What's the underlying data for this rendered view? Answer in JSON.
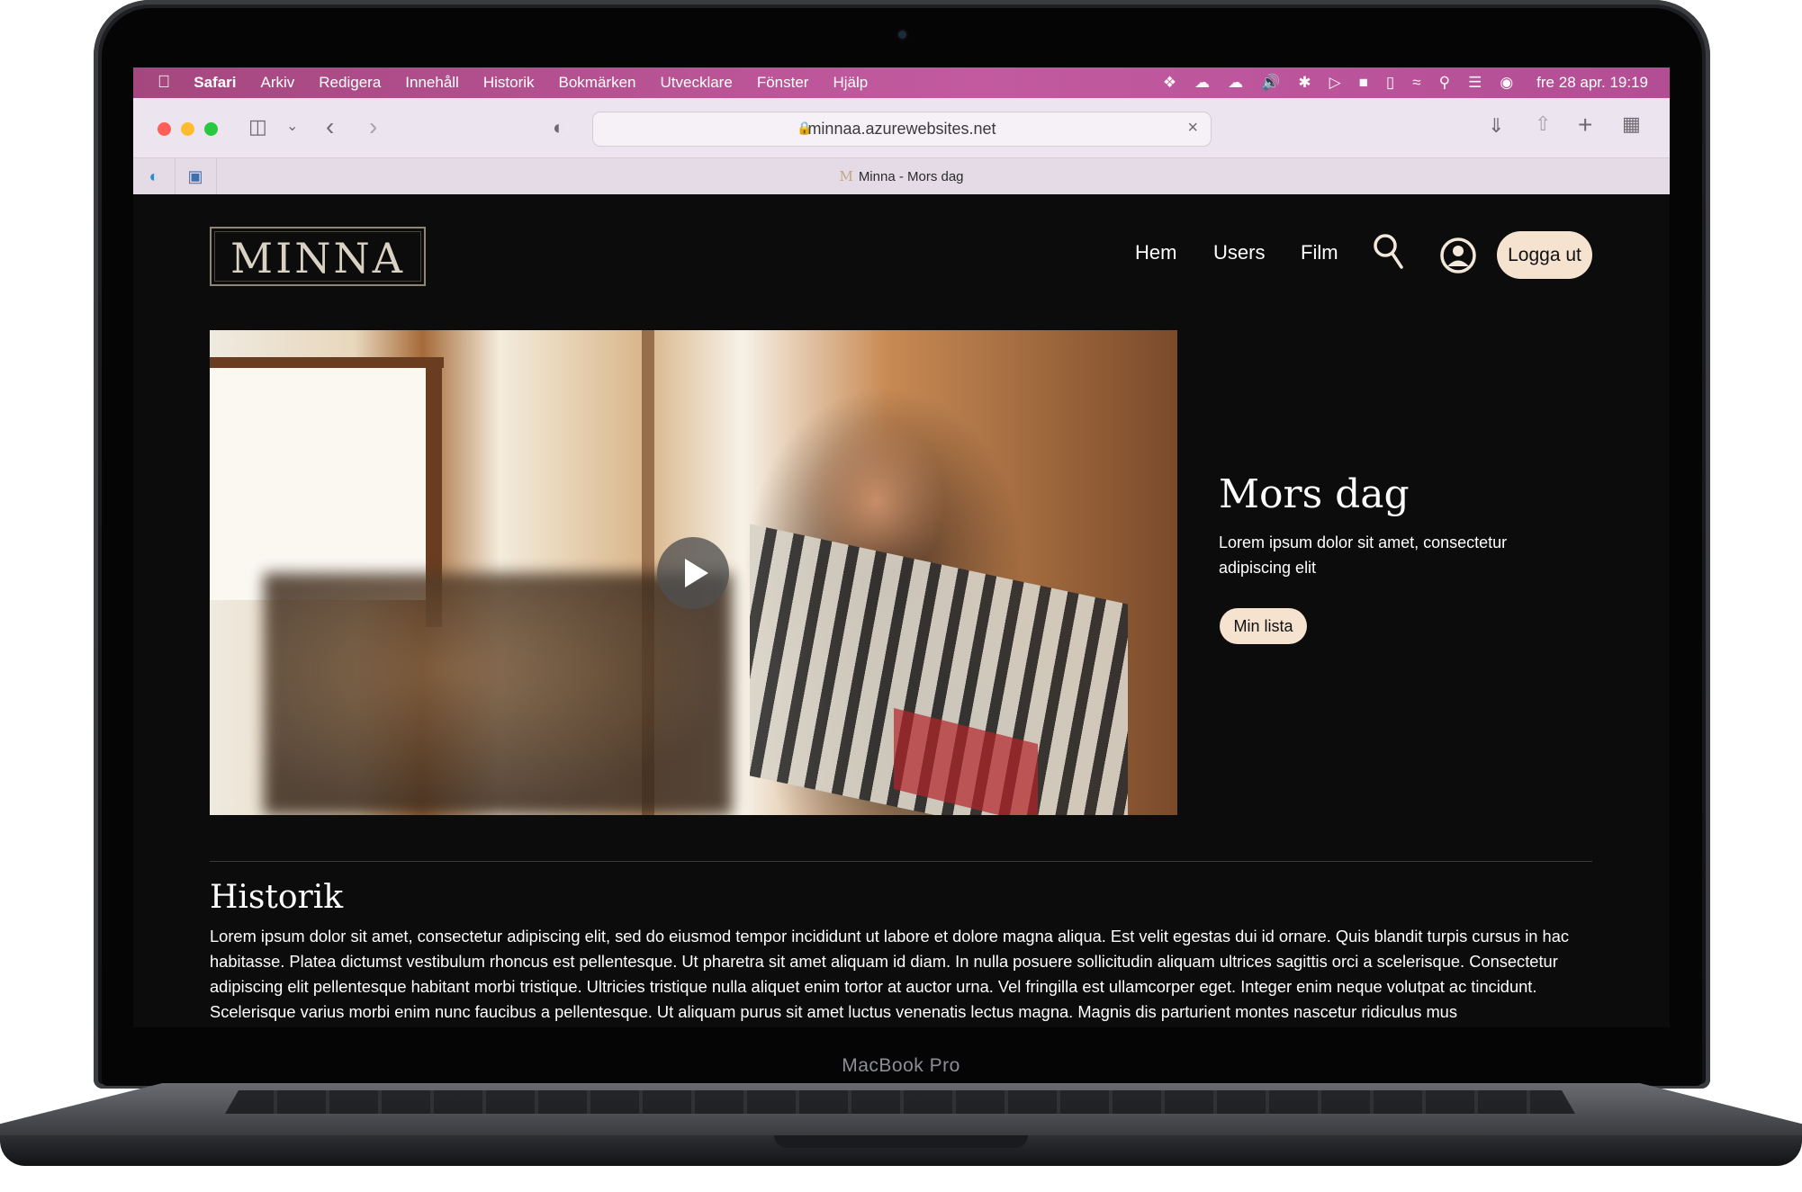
{
  "device": {
    "model_label": "MacBook Pro"
  },
  "menubar": {
    "apple_icon": "apple-logo-icon",
    "items": [
      "Safari",
      "Arkiv",
      "Redigera",
      "Innehåll",
      "Historik",
      "Bokmärken",
      "Utvecklare",
      "Fönster",
      "Hjälp"
    ],
    "status_icons": [
      "figma-icon",
      "weather-icon",
      "creative-cloud-icon",
      "volume-icon",
      "bluetooth-icon",
      "play-icon",
      "app-icon",
      "battery-icon",
      "wifi-icon",
      "search-icon",
      "control-center-icon",
      "siri-icon"
    ],
    "clock": "fre 28 apr.  19:19"
  },
  "browser": {
    "url": "minnaa.azurewebsites.net",
    "tab_title": "Minna - Mors dag",
    "pinned_tabs": [
      "edge-icon",
      "remote-icon"
    ]
  },
  "site": {
    "logo_text": "MINNA",
    "nav": [
      "Hem",
      "Users",
      "Film"
    ],
    "logout_label": "Logga ut",
    "feature": {
      "title": "Mors dag",
      "description": "Lorem ipsum dolor sit amet, consectetur adipiscing elit",
      "mylist_label": "Min lista"
    },
    "section": {
      "title": "Historik",
      "body": "Lorem ipsum dolor sit amet, consectetur adipiscing elit, sed do eiusmod tempor incididunt ut labore et dolore magna aliqua. Est velit egestas dui id ornare. Quis blandit turpis cursus in hac habitasse. Platea dictumst vestibulum rhoncus est pellentesque. Ut pharetra sit amet aliquam id diam. In nulla posuere sollicitudin aliquam ultrices sagittis orci a scelerisque. Consectetur adipiscing elit pellentesque habitant morbi tristique. Ultricies tristique nulla aliquet enim tortor at auctor urna. Vel fringilla est ullamcorper eget. Integer enim neque volutpat ac tincidunt. Scelerisque varius morbi enim nunc faucibus a pellentesque. Ut aliquam purus sit amet luctus venenatis lectus magna. Magnis dis parturient montes nascetur ridiculus mus"
    }
  },
  "colors": {
    "menubar": "#b34e94",
    "accent_button": "#f5e3d0",
    "background": "#0c0c0c"
  }
}
